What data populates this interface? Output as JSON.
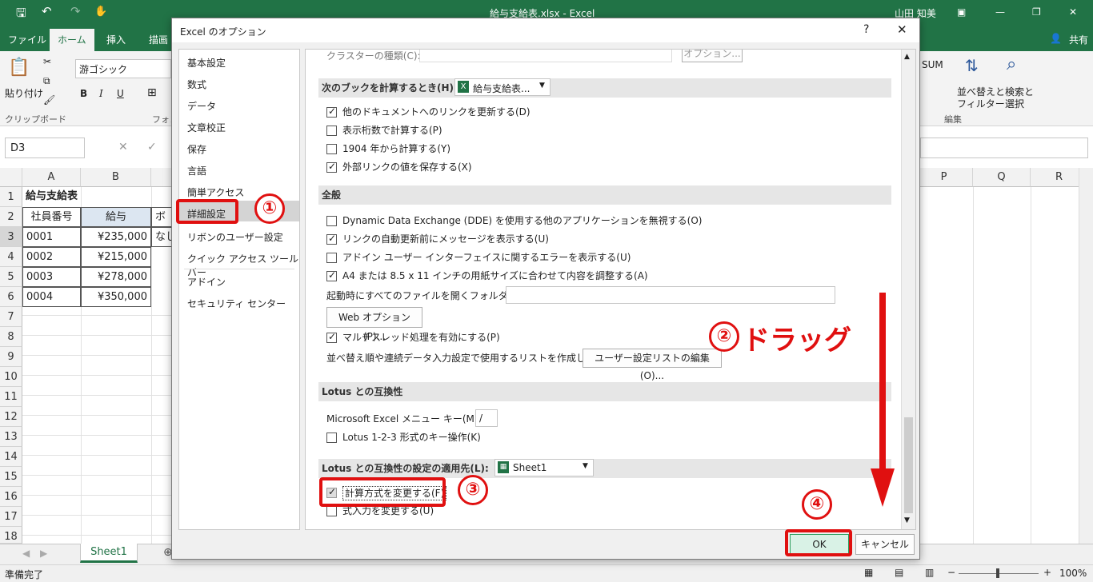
{
  "window": {
    "title": "給与支給表.xlsx  -  Excel",
    "user": "山田 知美"
  },
  "ribbon_tabs": [
    "ファイル",
    "ホーム",
    "挿入",
    "描画"
  ],
  "share": "共有",
  "ribbon": {
    "paste": "貼り付け",
    "font_name": "游ゴシック",
    "clipboard": "クリップボード",
    "font_group": "フォン",
    "sum": "SUM",
    "sort": "並べ替えと",
    "filter": "フィルター",
    "find": "検索と",
    "select": "選択",
    "edit_group": "編集",
    "bold": "B",
    "italic": "I",
    "underline": "U"
  },
  "namebox": "D3",
  "columns": [
    "A",
    "B",
    "P",
    "Q",
    "R"
  ],
  "rows": [
    "1",
    "2",
    "3",
    "4",
    "5",
    "6",
    "7",
    "8",
    "9",
    "10",
    "11",
    "12",
    "13",
    "14",
    "15",
    "16",
    "17",
    "18"
  ],
  "cells": {
    "title": "給与支給表",
    "h1": "社員番号",
    "h2": "給与",
    "h3": "ボ",
    "r1a": "0001",
    "r1b": "¥235,000",
    "r1c": "なし",
    "r2a": "0002",
    "r2b": "¥215,000",
    "r3a": "0003",
    "r3b": "¥278,000",
    "r4a": "0004",
    "r4b": "¥350,000"
  },
  "sheet": "Sheet1",
  "status": {
    "ready": "準備完了",
    "zoom": "100%"
  },
  "dialog": {
    "title": "Excel のオプション",
    "help": "?",
    "close": "✕",
    "nav": [
      "基本設定",
      "数式",
      "データ",
      "文章校正",
      "保存",
      "言語",
      "簡単アクセス",
      "詳細設定",
      "リボンのユーザー設定",
      "クイック アクセス ツール バー",
      "アドイン",
      "セキュリティ センター"
    ],
    "top_row": "クラスターの種類(C):",
    "top_btn": "オプション...",
    "calc_section": "次のブックを計算するとき(H):",
    "calc_book": "給与支給表...",
    "calc_opts": [
      "他のドキュメントへのリンクを更新する(D)",
      "表示桁数で計算する(P)",
      "1904 年から計算する(Y)",
      "外部リンクの値を保存する(X)"
    ],
    "general_section": "全般",
    "general_opts": [
      "Dynamic Data Exchange (DDE) を使用する他のアプリケーションを無視する(O)",
      "リンクの自動更新前にメッセージを表示する(U)",
      "アドイン ユーザー インターフェイスに関するエラーを表示する(U)",
      "A4 または 8.5 x 11 インチの用紙サイズに合わせて内容を調整する(A)"
    ],
    "startup_label": "起動時にすべてのファイルを開くフォルダー(L):",
    "web_btn": "Web オプション(P)...",
    "multi": "マルチスレッド処理を有効にする(P)",
    "sortlist_label": "並べ替え順や連続データ入力設定で使用するリストを作成します:",
    "sortlist_btn": "ユーザー設定リストの編集(O)...",
    "lotus_section": "Lotus との互換性",
    "menu_key": "Microsoft Excel メニュー キー(M):",
    "menu_key_val": "/",
    "lotus_key": "Lotus 1-2-3 形式のキー操作(K)",
    "lotus_apply_section": "Lotus との互換性の設定の適用先(L):",
    "lotus_sheet": "Sheet1",
    "calc_change": "計算方式を変更する(F)",
    "formula_change": "式入力を変更する(U)",
    "ok": "OK",
    "cancel": "キャンセル"
  },
  "annotations": {
    "n1": "①",
    "n2": "②",
    "drag": "ドラッグ",
    "n3": "③",
    "n4": "④"
  },
  "colors": {
    "excel_green": "#217346",
    "annotation_red": "#e01010"
  }
}
